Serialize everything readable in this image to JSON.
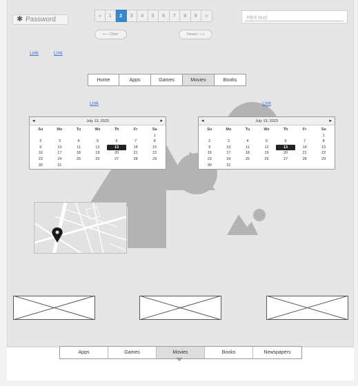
{
  "password": {
    "placeholder": "Password"
  },
  "pagination": {
    "prev": "«",
    "pages": [
      "1",
      "2",
      "3",
      "4",
      "5",
      "6",
      "7",
      "8",
      "9"
    ],
    "next": "»",
    "current": "2"
  },
  "hint": {
    "placeholder": "Hint text"
  },
  "older": "⟵ Older",
  "newer": "Newer ⟶",
  "links": {
    "top_left_1": "Link",
    "top_left_2": "Link",
    "cal1_link": "Link",
    "cal2_link": "Link"
  },
  "top_tabs": {
    "home": "Home",
    "apps": "Apps",
    "games": "Games",
    "movies": "Movies",
    "books": "Books",
    "selected": "Movies"
  },
  "calendar": {
    "month": "July 13, 2023",
    "weekdays": [
      "Su",
      "Mo",
      "Tu",
      "We",
      "Th",
      "Fr",
      "Sa"
    ],
    "weeks": [
      [
        "",
        "",
        "",
        "",
        "",
        "",
        "1"
      ],
      [
        "2",
        "3",
        "4",
        "5",
        "6",
        "7",
        "8"
      ],
      [
        "9",
        "10",
        "11",
        "12",
        "13",
        "14",
        "15"
      ],
      [
        "16",
        "17",
        "18",
        "19",
        "20",
        "21",
        "22"
      ],
      [
        "23",
        "24",
        "25",
        "26",
        "27",
        "28",
        "29"
      ],
      [
        "30",
        "31",
        "",
        "",
        "",
        "",
        ""
      ]
    ],
    "selected_day": "13"
  },
  "bottom_tabs": {
    "apps": "Apps",
    "games": "Games",
    "movies": "Movies",
    "books": "Books",
    "newspapers": "Newspapers",
    "selected": "Movies"
  },
  "colors": {
    "accent": "#3a86c8",
    "link": "#3c6fd8",
    "placeholder_shape": "#b3b3b3"
  }
}
